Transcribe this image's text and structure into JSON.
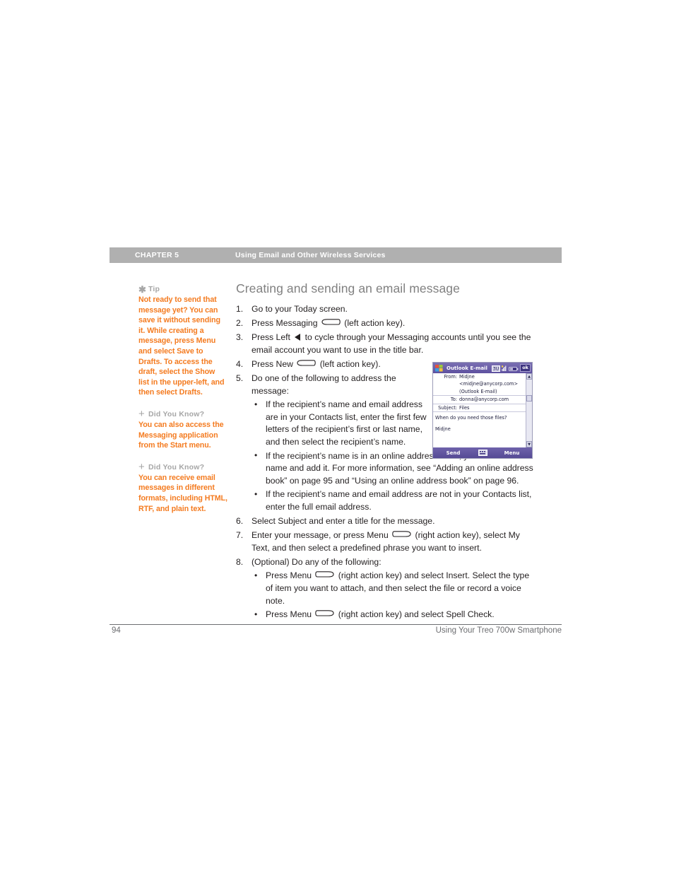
{
  "header": {
    "chapter": "CHAPTER 5",
    "title": "Using Email and Other Wireless Services"
  },
  "sidebar": {
    "tips": [
      {
        "icon": "asterisk-icon",
        "label": "Tip",
        "body": "Not ready to send that message yet? You can save it without sending it. While creating a message, press Menu and select Save to Drafts. To access the draft, select the Show list in the upper-left, and then select Drafts."
      },
      {
        "icon": "plus-icon",
        "label": "Did You Know?",
        "body": "You can also access the Messaging application from the Start menu."
      },
      {
        "icon": "plus-icon",
        "label": "Did You Know?",
        "body": "You can receive email messages in different formats, including HTML, RTF, and plain text."
      }
    ]
  },
  "main": {
    "section_title": "Creating and sending an email message",
    "steps": [
      {
        "num": "1.",
        "parts": [
          {
            "t": "text",
            "v": "Go to your Today screen."
          }
        ]
      },
      {
        "num": "2.",
        "parts": [
          {
            "t": "text",
            "v": "Press Messaging "
          },
          {
            "t": "icon",
            "v": "left-action-key-icon"
          },
          {
            "t": "text",
            "v": " (left action key)."
          }
        ]
      },
      {
        "num": "3.",
        "parts": [
          {
            "t": "text",
            "v": "Press Left "
          },
          {
            "t": "icon",
            "v": "left-arrow-icon"
          },
          {
            "t": "text",
            "v": " to cycle through your Messaging accounts until you see the email account you want to use in the title bar."
          }
        ]
      },
      {
        "num": "4.",
        "parts": [
          {
            "t": "text",
            "v": "Press New "
          },
          {
            "t": "icon",
            "v": "left-action-key-icon"
          },
          {
            "t": "text",
            "v": " (left action key)."
          }
        ]
      },
      {
        "num": "5.",
        "parts": [
          {
            "t": "text",
            "v": "Do one of the following to address the message:"
          }
        ],
        "narrow": true,
        "bullets": [
          {
            "narrow": true,
            "parts": [
              {
                "t": "text",
                "v": "If the recipient’s name and email address are in your Contacts list, enter the first few letters of the recipient’s first or last name, and then select the recipient’s name."
              }
            ]
          },
          {
            "narrow": false,
            "parts": [
              {
                "t": "text",
                "v": "If the recipient’s name is in an online address book, you can find the name and add it. For more information, see “Adding an online address book” on page 95 and “Using an online address book” on page 96."
              }
            ],
            "narrow_first_lines": true
          },
          {
            "narrow": false,
            "parts": [
              {
                "t": "text",
                "v": "If the recipient’s name and email address are not in your Contacts list, enter the full email address."
              }
            ]
          }
        ]
      },
      {
        "num": "6.",
        "parts": [
          {
            "t": "text",
            "v": "Select Subject and enter a title for the message."
          }
        ]
      },
      {
        "num": "7.",
        "parts": [
          {
            "t": "text",
            "v": "Enter your message, or press Menu "
          },
          {
            "t": "icon",
            "v": "right-action-key-icon"
          },
          {
            "t": "text",
            "v": " (right action key), select My Text, and then select a predefined phrase you want to insert."
          }
        ]
      },
      {
        "num": "8.",
        "parts": [
          {
            "t": "text",
            "v": "(Optional) Do any of the following:"
          }
        ],
        "bullets": [
          {
            "parts": [
              {
                "t": "text",
                "v": "Press Menu "
              },
              {
                "t": "icon",
                "v": "right-action-key-icon"
              },
              {
                "t": "text",
                "v": " (right action key) and select Insert. Select the type of item you want to attach, and then select the file or record a voice note."
              }
            ]
          },
          {
            "parts": [
              {
                "t": "text",
                "v": "Press Menu "
              },
              {
                "t": "icon",
                "v": "right-action-key-icon"
              },
              {
                "t": "text",
                "v": " (right action key) and select Spell Check."
              }
            ]
          }
        ]
      }
    ]
  },
  "device": {
    "title": "Outlook E-mail",
    "status_icons": [
      "sync-icon",
      "signal-icon",
      "battery-icon"
    ],
    "ok_label": "ok",
    "fields": [
      {
        "label": "From:",
        "value": "Midjne"
      },
      {
        "label": "",
        "value": "<midjne@anycorp.com>"
      },
      {
        "label": "",
        "value": "(Outlook E-mail)"
      },
      {
        "label": "To:",
        "value": "donna@anycorp.com"
      },
      {
        "label": "Subject:",
        "value": "Files"
      }
    ],
    "body_text": "When do you need those files?",
    "signature": "Midjne",
    "softkeys": {
      "left": "Send",
      "middle": "keyboard-icon",
      "right": "Menu"
    },
    "scrollbar": {
      "up": "▲",
      "down": "▼"
    }
  },
  "footer": {
    "page_number": "94",
    "book_title": "Using Your Treo 700w Smartphone"
  },
  "colors": {
    "accent_orange": "#f47b20",
    "header_gray": "#b0b0b0",
    "title_gray": "#808080",
    "device_purple": "#6b5fa5"
  }
}
